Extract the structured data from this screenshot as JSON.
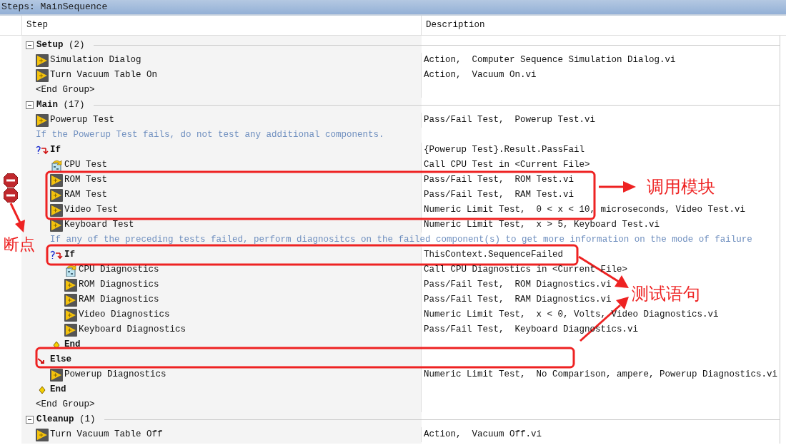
{
  "window": {
    "title": "Steps: MainSequence"
  },
  "columns": [
    "Step",
    "Description"
  ],
  "groups": [
    {
      "name": "Setup",
      "count": "(2)",
      "expanded": true,
      "end_label": "<End Group>",
      "items": [
        {
          "kind": "step",
          "name": "Simulation Dialog",
          "description": "Action,  Computer Sequence Simulation Dialog.vi",
          "breakpoint": false
        },
        {
          "kind": "step",
          "name": "Turn Vacuum Table On",
          "description": "Action,  Vacuum On.vi",
          "breakpoint": false
        }
      ]
    },
    {
      "name": "Main",
      "count": "(17)",
      "expanded": true,
      "end_label": "<End Group>",
      "items": [
        {
          "kind": "step",
          "name": "Powerup Test",
          "description": "Pass/Fail Test,  Powerup Test.vi",
          "breakpoint": false
        },
        {
          "kind": "comment",
          "text": "If the Powerup Test fails, do not test any additional components."
        },
        {
          "kind": "if",
          "name": "If",
          "description": "{Powerup Test}.Result.PassFail",
          "children": [
            {
              "kind": "call",
              "name": "CPU Test",
              "description": "Call CPU Test in <Current File>",
              "breakpoint": false
            },
            {
              "kind": "step",
              "name": "ROM Test",
              "description": "Pass/Fail Test,  ROM Test.vi",
              "breakpoint": true
            },
            {
              "kind": "step",
              "name": "RAM Test",
              "description": "Pass/Fail Test,  RAM Test.vi",
              "breakpoint": true
            },
            {
              "kind": "step",
              "name": "Video Test",
              "description": "Numeric Limit Test,  0 < x < 10, microseconds, Video Test.vi",
              "breakpoint": false
            },
            {
              "kind": "step",
              "name": "Keyboard Test",
              "description": "Numeric Limit Test,  x > 5, Keyboard Test.vi",
              "breakpoint": false
            },
            {
              "kind": "comment",
              "text": "If any of the preceding tests failed, perform diagnositcs on the failed component(s) to get more information on the mode of failure"
            },
            {
              "kind": "if",
              "name": "If",
              "description": "ThisContext.SequenceFailed",
              "children": [
                {
                  "kind": "call",
                  "name": "CPU Diagnostics",
                  "description": "Call CPU Diagnostics in <Current File>",
                  "breakpoint": false
                },
                {
                  "kind": "step",
                  "name": "ROM Diagnostics",
                  "description": "Pass/Fail Test,  ROM Diagnostics.vi",
                  "breakpoint": false
                },
                {
                  "kind": "step",
                  "name": "RAM Diagnostics",
                  "description": "Pass/Fail Test,  RAM Diagnostics.vi",
                  "breakpoint": false
                },
                {
                  "kind": "step",
                  "name": "Video Diagnostics",
                  "description": "Numeric Limit Test,  x < 0, Volts, Video Diagnostics.vi",
                  "breakpoint": false
                },
                {
                  "kind": "step",
                  "name": "Keyboard Diagnostics",
                  "description": "Pass/Fail Test,  Keyboard Diagnostics.vi",
                  "breakpoint": false
                }
              ]
            },
            {
              "kind": "end",
              "name": "End"
            }
          ]
        },
        {
          "kind": "else",
          "name": "Else",
          "children": [
            {
              "kind": "step",
              "name": "Powerup Diagnostics",
              "description": "Numeric Limit Test,  No Comparison, ampere, Powerup Diagnostics.vi",
              "breakpoint": false
            }
          ]
        },
        {
          "kind": "end",
          "name": "End"
        }
      ]
    },
    {
      "name": "Cleanup",
      "count": "(1)",
      "expanded": true,
      "items": [
        {
          "kind": "step",
          "name": "Turn Vacuum Table Off",
          "description": "Action,  Vacuum Off.vi",
          "breakpoint": false
        }
      ]
    }
  ],
  "annotations": [
    {
      "text": "调用模块"
    },
    {
      "text": "测试语句"
    },
    {
      "text": "断点"
    }
  ]
}
